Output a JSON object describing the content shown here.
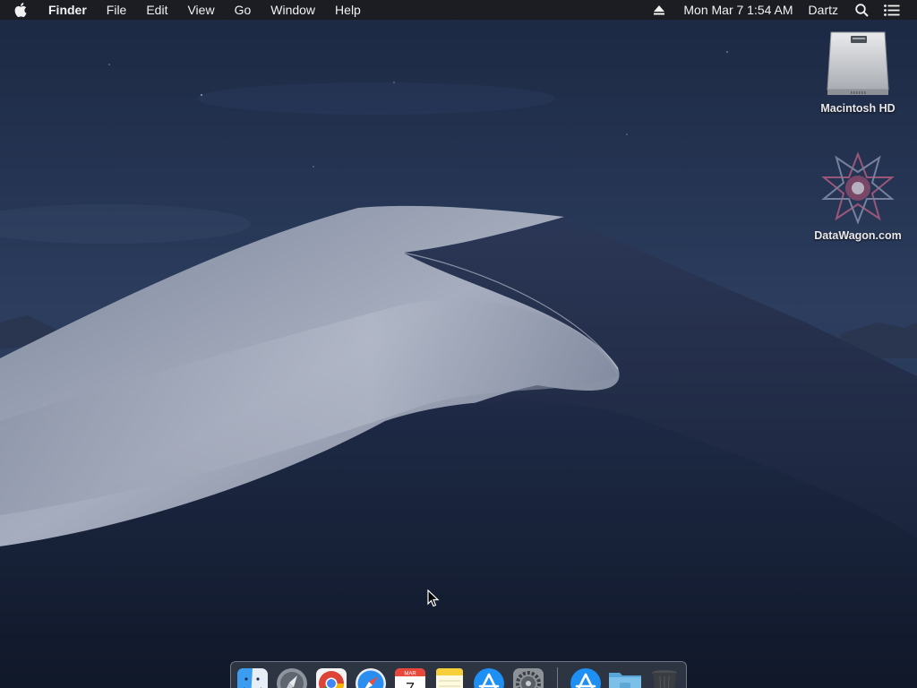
{
  "menubar": {
    "apple_icon": "apple-logo-icon",
    "app_name": "Finder",
    "menus": [
      "File",
      "Edit",
      "View",
      "Go",
      "Window",
      "Help"
    ],
    "status": {
      "eject_icon": "eject-icon",
      "datetime": "Mon Mar 7  1:54 AM",
      "user": "Dartz",
      "search_icon": "spotlight-search-icon",
      "notifications_icon": "notification-center-icon"
    }
  },
  "desktop": {
    "icons": [
      {
        "label": "Macintosh HD",
        "icon": "hard-drive-icon"
      },
      {
        "label": "DataWagon.com",
        "icon": "datawagon-logo-icon"
      }
    ]
  },
  "dock": {
    "apps": [
      {
        "name": "Finder",
        "icon": "finder-icon"
      },
      {
        "name": "Launchpad",
        "icon": "launchpad-icon"
      },
      {
        "name": "Google Chrome",
        "icon": "chrome-icon"
      },
      {
        "name": "Safari",
        "icon": "safari-icon"
      },
      {
        "name": "Calendar",
        "icon": "calendar-icon",
        "month": "MAR",
        "day": "7"
      },
      {
        "name": "Notes",
        "icon": "notes-icon"
      },
      {
        "name": "App Store",
        "icon": "app-store-icon"
      },
      {
        "name": "System Preferences",
        "icon": "system-preferences-icon"
      },
      {
        "name": "Applications",
        "icon": "applications-stack-icon"
      },
      {
        "name": "Downloads",
        "icon": "downloads-folder-icon"
      },
      {
        "name": "Trash",
        "icon": "trash-icon"
      }
    ]
  },
  "colors": {
    "menubar_bg": "#1c1d21",
    "sky_top": "#1d2b45",
    "dune_light": "#a9b0c2",
    "dune_dark": "#1b2540"
  }
}
